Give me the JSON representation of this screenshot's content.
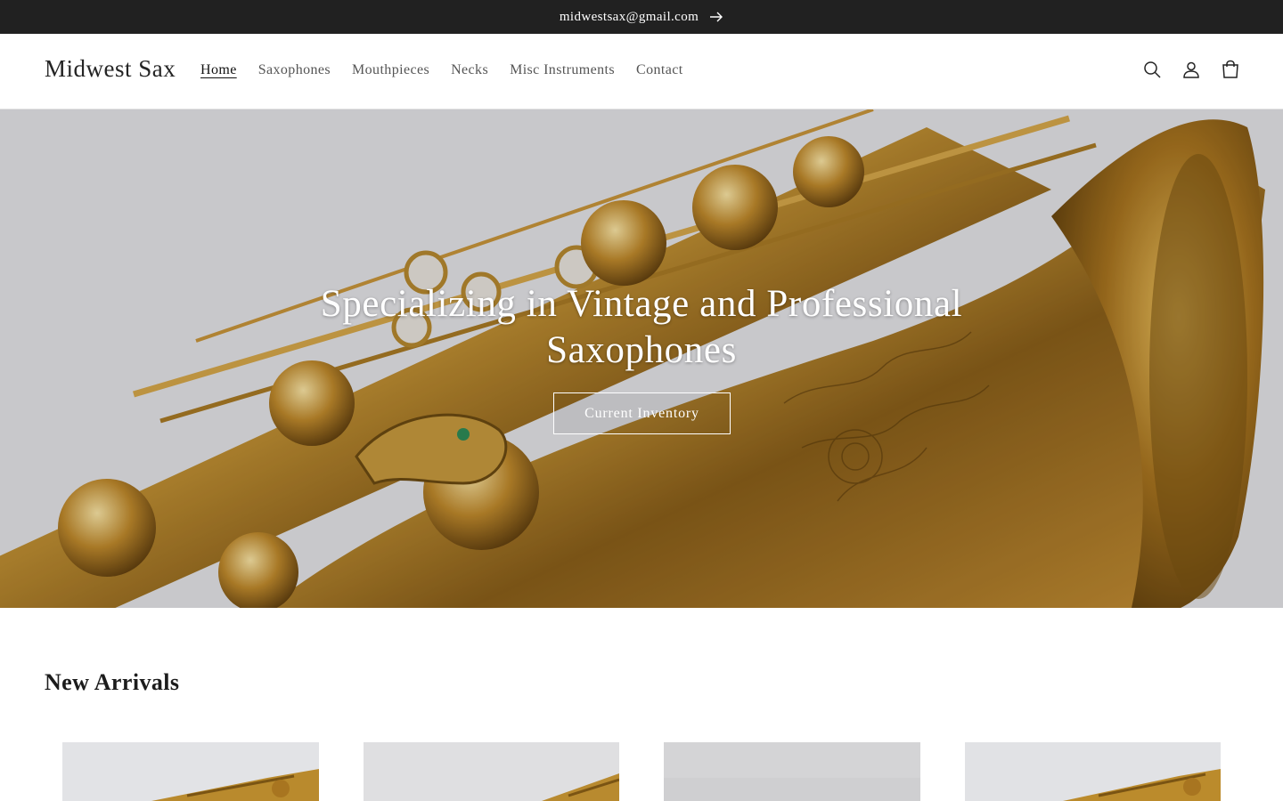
{
  "announcement": {
    "text": "midwestsax@gmail.com",
    "icon": "arrow-right-icon"
  },
  "header": {
    "logo": "Midwest Sax",
    "nav": [
      {
        "label": "Home",
        "active": true
      },
      {
        "label": "Saxophones"
      },
      {
        "label": "Mouthpieces"
      },
      {
        "label": "Necks"
      },
      {
        "label": "Misc Instruments"
      },
      {
        "label": "Contact"
      }
    ],
    "icons": [
      "search-icon",
      "account-icon",
      "cart-icon"
    ]
  },
  "hero": {
    "title_line1": "Specializing in Vintage and Professional",
    "title_line2": "Saxophones",
    "button": "Current Inventory"
  },
  "new_arrivals": {
    "title": "New Arrivals"
  },
  "colors": {
    "announcement_bg": "#212121",
    "brass": "#b8862b",
    "hero_bg": "#e3e3e6"
  }
}
